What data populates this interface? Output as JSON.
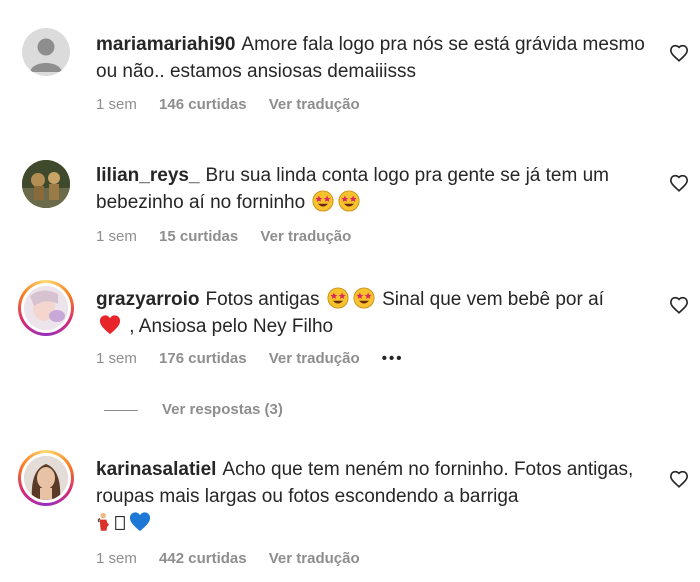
{
  "comments": [
    {
      "username": "mariamariahi90",
      "text": "Amore fala logo pra nós se está grávida mesmo ou não.. estamos ansiosas demaiiisss",
      "time": "1 sem",
      "likes": "146 curtidas",
      "translate": "Ver tradução"
    },
    {
      "username": "lilian_reys_",
      "text": "Bru sua linda conta logo pra gente se já tem um bebezinho aí no forninho",
      "emoji_after": "star-struck-face-emoji x2",
      "time": "1 sem",
      "likes": "15 curtidas",
      "translate": "Ver tradução"
    },
    {
      "username": "grazyarroio",
      "text_before": "Fotos antigas",
      "text_after": "Sinal que vem bebê por aí",
      "text_line2": ", Ansiosa pelo Ney Filho",
      "time": "1 sem",
      "likes": "176 curtidas",
      "translate": "Ver tradução",
      "more": "•••"
    },
    {
      "username": "karinasalatiel",
      "text": "Acho que tem neném no forninho. Fotos antigas, roupas mais largas ou fotos escondendo a barriga",
      "emoji_line": "pregnant-woman, missing-glyph, blue-heart",
      "time": "1 sem",
      "likes": "442 curtidas",
      "translate": "Ver tradução"
    }
  ],
  "replies_link": "Ver respostas (3)",
  "colors": {
    "text": "#262626",
    "secondary": "#8e8e8e",
    "story_ring": [
      "#feda75",
      "#fa7e1e",
      "#d62976",
      "#962fbf"
    ]
  }
}
